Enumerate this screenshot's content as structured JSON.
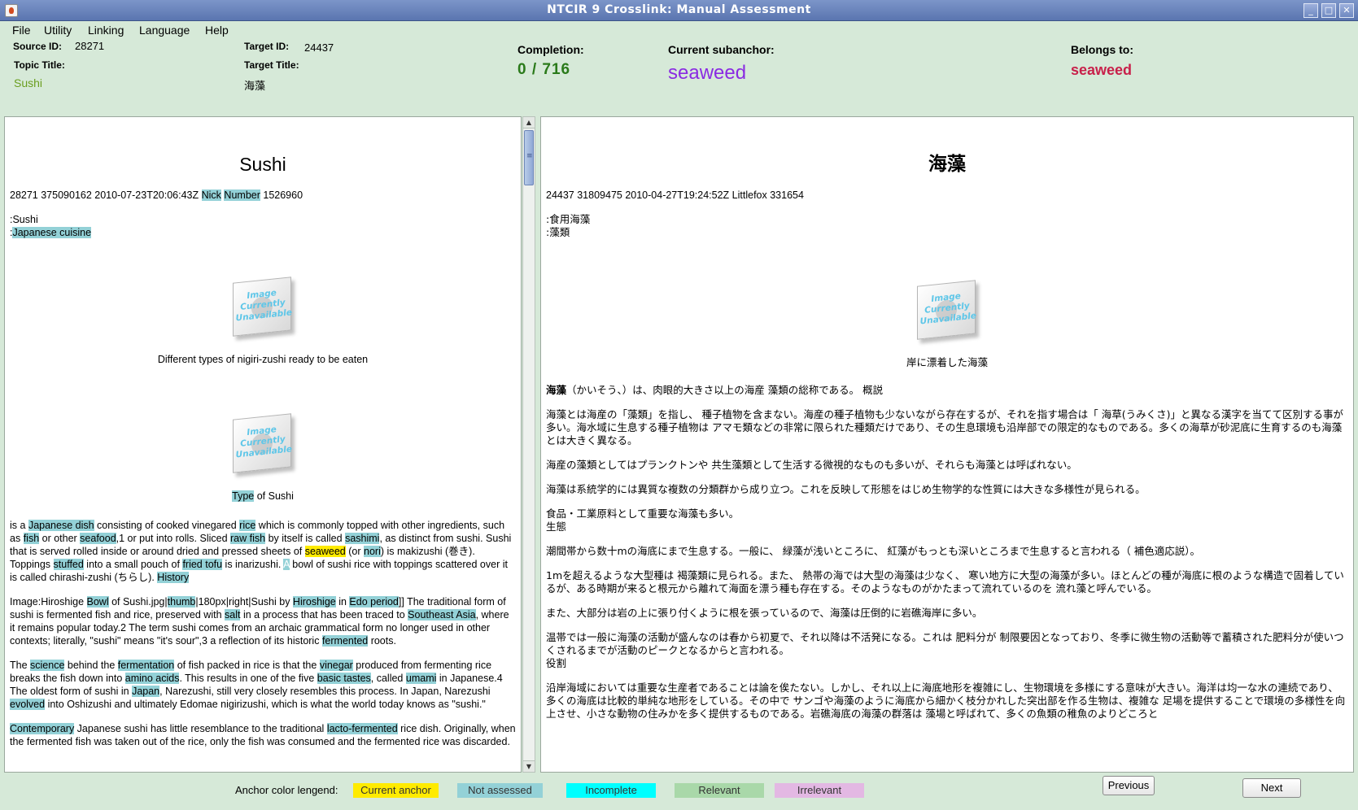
{
  "window": {
    "title": "NTCIR 9 Crosslink: Manual Assessment",
    "controls": [
      "_",
      "□",
      "✕"
    ]
  },
  "menu": [
    "File",
    "Utility",
    "Linking",
    "Language",
    "Help"
  ],
  "header": {
    "source_id_label": "Source ID:",
    "source_id": "28271",
    "topic_title_label": "Topic Title:",
    "topic_title": "Sushi",
    "target_id_label": "Target ID:",
    "target_id": "24437",
    "target_title_label": "Target Title:",
    "target_title": "海藻",
    "completion_label": "Completion:",
    "completion": "0 / 716",
    "subanchor_label": "Current subanchor:",
    "subanchor": "seaweed",
    "belongs_label": "Belongs to:",
    "belongs": "seaweed",
    "colors": {
      "topic_title": "#6a9e1f",
      "completion": "#2a7a1a",
      "subanchor": "#8a2be2",
      "belongs": "#c8204a"
    }
  },
  "left": {
    "title": "Sushi",
    "meta": [
      "28271 375090162 2010-07-23T20:06:43Z ",
      "Nick",
      " ",
      "Number",
      " 1526960"
    ],
    "cats": [
      ":Sushi",
      ":",
      "Japanese cuisine"
    ],
    "img1_text": "Image Currently Unavailable",
    "img1_caption": "Different types of nigiri-zushi ready to be eaten",
    "img2_text": "Image Currently Unavailable",
    "img2_caption_anchor": "Type",
    "img2_caption_rest": " of Sushi",
    "p1": [
      "is a ",
      "Japanese dish",
      " consisting of cooked vinegared ",
      "rice",
      " which is commonly topped with other ingredients, such as ",
      "fish",
      " or other ",
      "seafood",
      ",1 or put into rolls. Sliced ",
      "raw fish",
      " by itself is called ",
      "sashimi",
      ", as distinct from sushi. Sushi that is served rolled inside or around dried and pressed sheets of ",
      "seaweed",
      " (or ",
      "nori",
      ") is makizushi (巻き). Toppings ",
      "stuffed",
      " into a small pouch of ",
      "fried tofu",
      " is inarizushi. ",
      "A",
      " bowl of sushi rice with toppings scattered over it is called chirashi-zushi (ちらし). ",
      "History"
    ],
    "p2": [
      "Image:Hiroshige ",
      "Bowl",
      " of Sushi.jpg|",
      "thumb",
      "|180px|right|Sushi by ",
      "Hiroshige",
      " in ",
      "Edo period",
      "]] The traditional form of sushi is fermented fish and rice, preserved with ",
      "salt",
      " in a process that has been traced to ",
      "Southeast Asia",
      ", where it remains popular today.2 The term sushi comes from an archaic grammatical form no longer used in other contexts; literally, \"sushi\" means \"it's sour\",3 a reflection of its historic ",
      "fermented",
      " roots."
    ],
    "p3": [
      "The ",
      "science",
      " behind the ",
      "fermentation",
      " of fish packed in rice is that the ",
      "vinegar",
      " produced from fermenting rice breaks the fish down into ",
      "amino acids",
      ". This results in one of the five ",
      "basic tastes",
      ", called ",
      "umami",
      " in Japanese.4 The oldest form of sushi in ",
      "Japan",
      ", Narezushi, still very closely resembles this process. In Japan, Narezushi ",
      "evolved",
      " into Oshizushi and ultimately Edomae nigirizushi, which is what the world today knows as \"sushi.\""
    ],
    "p4": [
      "Contemporary",
      " Japanese sushi has little resemblance to the traditional ",
      "lacto-fermented",
      " rice dish. Originally, when the fermented fish was taken out of the rice, only the fish was consumed and the fermented rice was discarded."
    ]
  },
  "right": {
    "title": "海藻",
    "meta": "24437 31809475 2010-04-27T19:24:52Z Littlefox 331654",
    "cats": [
      ":食用海藻",
      ":藻類"
    ],
    "img_text": "Image Currently Unavailable",
    "img_caption": "岸に漂着した海藻",
    "p1_bold": "海藻",
    "p1_rest": "（かいそう、）は、肉眼的大きさ以上の海産 藻類の総称である。 概説",
    "p2": "海藻とは海産の「藻類」を指し、 種子植物を含まない。海産の種子植物も少ないながら存在するが、それを指す場合は「 海草(うみくさ)」と異なる漢字を当てて区別する事が多い。海水域に生息する種子植物は アマモ類などの非常に限られた種類だけであり、その生息環境も沿岸部での限定的なものである。多くの海草が砂泥底に生育するのも海藻とは大きく異なる。",
    "p3": "海産の藻類としてはプランクトンや 共生藻類として生活する微視的なものも多いが、それらも海藻とは呼ばれない。",
    "p4": "海藻は系統学的には異質な複数の分類群から成り立つ。これを反映して形態をはじめ生物学的な性質には大きな多様性が見られる。",
    "p5a": "食品・工業原料として重要な海藻も多い。",
    "p5b": "生態",
    "p6": "潮間帯から数十mの海底にまで生息する。一般に、 緑藻が浅いところに、 紅藻がもっとも深いところまで生息すると言われる（ 補色適応説）。",
    "p7": "1mを超えるような大型種は 褐藻類に見られる。また、 熱帯の海では大型の海藻は少なく、 寒い地方に大型の海藻が多い。ほとんどの種が海底に根のような構造で固着しているが、ある時期が来ると根元から離れて海面を漂う種も存在する。そのようなものがかたまって流れているのを 流れ藻と呼んでいる。",
    "p8": "また、大部分は岩の上に張り付くように根を張っているので、海藻は圧倒的に岩礁海岸に多い。",
    "p9": "温帯では一般に海藻の活動が盛んなのは春から初夏で、それ以降は不活発になる。これは 肥料分が 制限要因となっており、冬季に微生物の活動等で蓄積された肥料分が使いつくされるまでが活動のピークとなるからと言われる。",
    "p9b": "役割",
    "p10": "沿岸海域においては重要な生産者であることは論を俟たない。しかし、それ以上に海底地形を複雑にし、生物環境を多様にする意味が大きい。海洋は均一な水の連続であり、多くの海底は比較的単純な地形をしている。その中で サンゴや海藻のように海底から細かく枝分かれした突出部を作る生物は、複雑な 足場を提供することで環境の多様性を向上させ、小さな動物の住みかを多く提供するものである。岩礁海底の海藻の群落は 藻場と呼ばれて、多くの魚類の稚魚のよりどころと"
  },
  "legend": {
    "label": "Anchor color lengend:",
    "items": [
      {
        "label": "Current anchor",
        "color": "#ffeb00",
        "text": "#333333"
      },
      {
        "label": "Not assessed",
        "color": "#93d1d7",
        "text": "#333333"
      },
      {
        "label": "Incomplete",
        "color": "#00ffff",
        "text": "#333333"
      },
      {
        "label": "Relevant",
        "color": "#a9d8a9",
        "text": "#333333"
      },
      {
        "label": "Irrelevant",
        "color": "#e3b8e3",
        "text": "#333333"
      }
    ]
  },
  "buttons": {
    "previous": "Previous",
    "next": "Next"
  }
}
